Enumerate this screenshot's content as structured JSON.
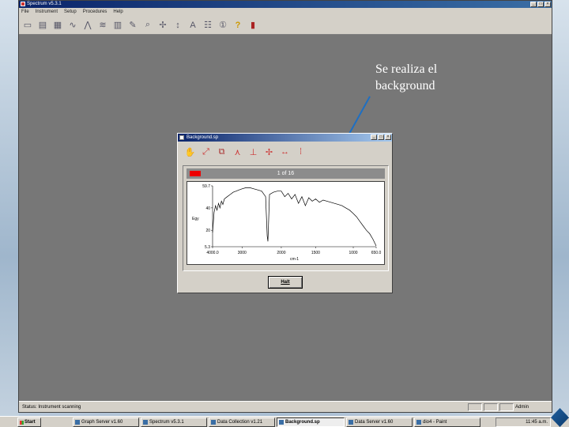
{
  "app": {
    "title": "Spectrum v5.3.1",
    "menu": [
      "File",
      "Instrument",
      "Setup",
      "Procedures",
      "Help"
    ],
    "toolbar_icons": [
      "open-icon",
      "print-icon",
      "view-icon",
      "spectrum-icon",
      "peaks-icon",
      "compare-icon",
      "library-icon",
      "graph-icon",
      "zoom-icon",
      "move-icon",
      "scale-icon",
      "text-icon",
      "grid-icon",
      "info-icon",
      "help-icon",
      "exit-icon"
    ]
  },
  "annotation": {
    "text": "Se realiza el\nbackground"
  },
  "child_window": {
    "title": "Background.sp",
    "tools": [
      "halt-icon",
      "scale-icon",
      "overlay-icon",
      "peak-icon",
      "axis-icon",
      "move-icon",
      "range-icon",
      "marker-icon"
    ],
    "counter": "1 of 16",
    "ok_label": "Halt"
  },
  "chart_data": {
    "type": "line",
    "title": "",
    "xlabel": "cm-1",
    "ylabel": "Egy",
    "x_ticks": [
      "4000.0",
      "3000",
      "2000",
      "1500",
      "1000",
      "650.0"
    ],
    "y_ticks": [
      "59.7",
      "40",
      "20",
      "5.3"
    ],
    "xlim": [
      4000,
      650
    ],
    "ylim": [
      5.3,
      59.7
    ],
    "series": [
      {
        "x": [
          4000,
          3950,
          3900,
          3850,
          3800,
          3750,
          3700,
          3650,
          3600,
          3500,
          3400,
          3300,
          3200,
          3100,
          3000,
          2900,
          2800,
          2700,
          2600,
          2500,
          2400,
          2360,
          2340,
          2320,
          2300,
          2200,
          2100,
          2000,
          1950,
          1900,
          1850,
          1800,
          1750,
          1700,
          1650,
          1600,
          1550,
          1500,
          1450,
          1400,
          1350,
          1300,
          1250,
          1200,
          1150,
          1100,
          1050,
          1000,
          950,
          900,
          850,
          800,
          750,
          700,
          650
        ],
        "y": [
          18,
          36,
          42,
          38,
          44,
          40,
          46,
          43,
          48,
          50,
          52,
          54,
          55,
          56,
          57,
          58,
          58,
          57,
          56,
          55,
          50,
          15,
          10,
          30,
          52,
          54,
          55,
          55,
          50,
          53,
          48,
          52,
          44,
          50,
          42,
          49,
          46,
          48,
          45,
          47,
          46,
          45,
          44,
          43,
          42,
          40,
          38,
          35,
          32,
          28,
          24,
          20,
          17,
          12,
          6
        ]
      }
    ],
    "grid": false,
    "legend": "none"
  },
  "status": {
    "text": "Status: Instrument scanning",
    "user": "Admin"
  },
  "taskbar": {
    "start": "Start",
    "tasks": [
      "Graph Server v1.60",
      "Spectrum v5.3.1",
      "Data Collection v1.21",
      "Background.sp",
      "Data Server v1.60",
      "dio4 - Paint"
    ],
    "clock": "11:45 a.m."
  }
}
